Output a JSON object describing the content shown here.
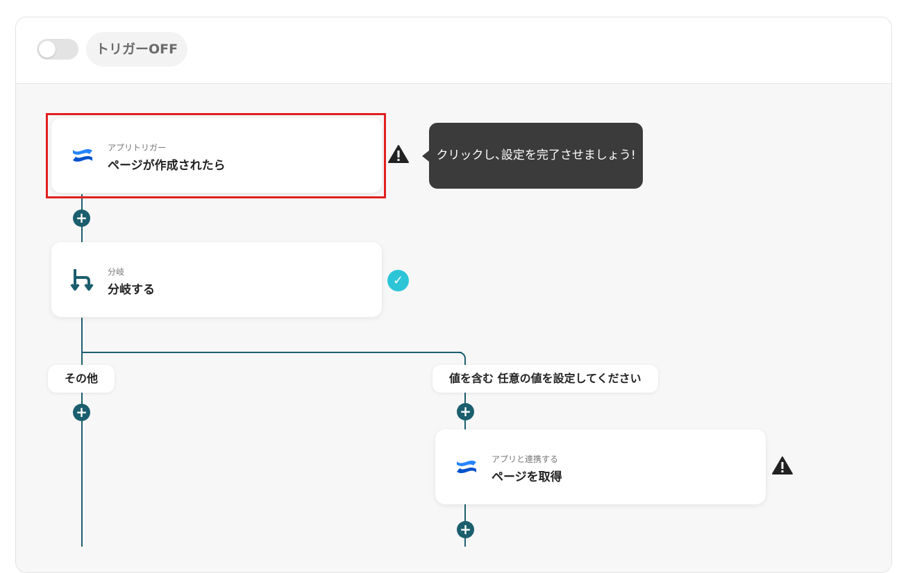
{
  "header": {
    "toggle_state": "off",
    "trigger_label": "トリガーOFF"
  },
  "colors": {
    "flow_line": "#1b5e6e",
    "highlight": "#e21f1f",
    "check": "#2cc5d8",
    "tooltip_bg": "#3b3b3b"
  },
  "steps": [
    {
      "icon": "confluence-icon",
      "subtitle": "アプリトリガー",
      "title": "ページが作成されたら",
      "status": "warning",
      "highlighted": true
    },
    {
      "icon": "branch-icon",
      "subtitle": "分岐",
      "title": "分岐する",
      "status": "complete"
    },
    {
      "icon": "confluence-icon",
      "subtitle": "アプリと連携する",
      "title": "ページを取得",
      "status": "warning"
    }
  ],
  "tooltip": {
    "text": "クリックし､設定を完了させましょう!"
  },
  "branches": {
    "left_label": "その他",
    "right_label": "値を含む 任意の値を設定してください"
  }
}
